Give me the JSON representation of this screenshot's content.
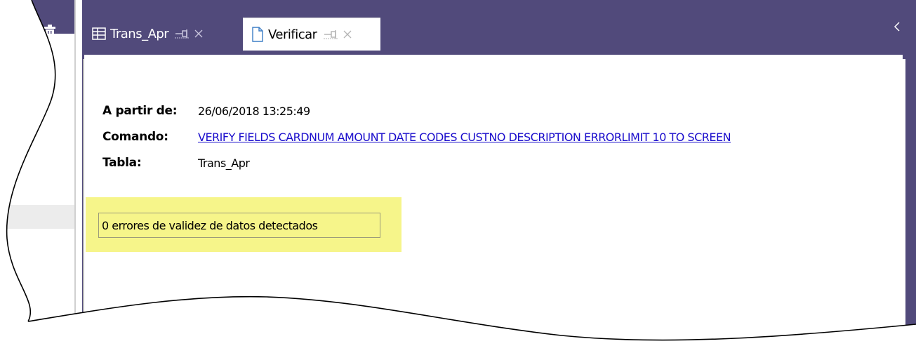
{
  "tabs": [
    {
      "label": "Trans_Apr",
      "icon": "table-icon",
      "active": false
    },
    {
      "label": "Verificar",
      "icon": "document-icon",
      "active": true
    }
  ],
  "result": {
    "from_label": "A partir de:",
    "from_value": "26/06/2018 13:25:49",
    "command_label": "Comando:",
    "command_value": "VERIFY FIELDS CARDNUM AMOUNT DATE CODES CUSTNO DESCRIPTION ERRORLIMIT 10 TO SCREEN",
    "table_label": "Tabla:",
    "table_value": "Trans_Apr",
    "summary": "0 errores de validez de datos detectados"
  },
  "colors": {
    "header_bg": "#514a7b",
    "highlight": "#f6f58a",
    "link": "#1a0dcc"
  }
}
